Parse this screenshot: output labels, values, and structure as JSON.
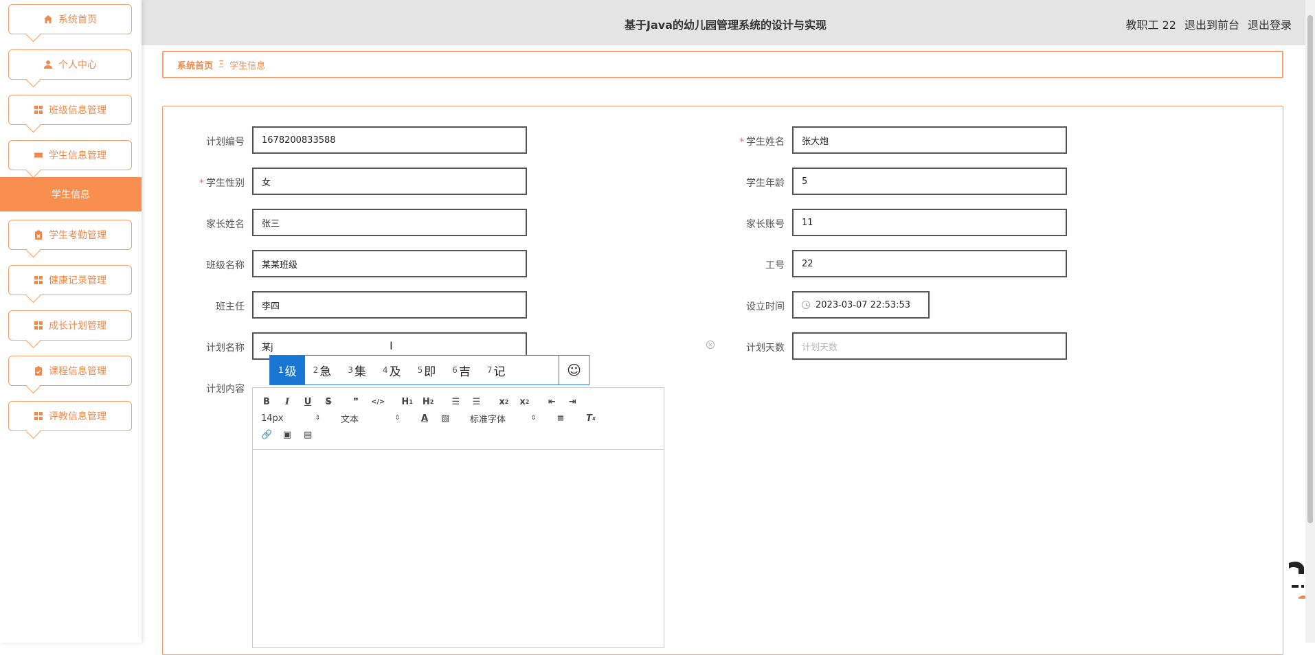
{
  "sidebar": {
    "items": [
      {
        "label": "系统首页",
        "icon": "home-icon"
      },
      {
        "label": "个人中心",
        "icon": "user-icon"
      },
      {
        "label": "班级信息管理",
        "icon": "grid-icon"
      },
      {
        "label": "学生信息管理",
        "icon": "ticket-icon"
      },
      {
        "label": "学生考勤管理",
        "icon": "clipboard-icon"
      },
      {
        "label": "健康记录管理",
        "icon": "grid-icon"
      },
      {
        "label": "成长计划管理",
        "icon": "grid-icon"
      },
      {
        "label": "课程信息管理",
        "icon": "clipboard-icon"
      },
      {
        "label": "评教信息管理",
        "icon": "grid-icon"
      }
    ],
    "active_sub": "学生信息"
  },
  "header": {
    "title": "基于Java的幼儿园管理系统的设计与实现",
    "user": "教职工 22",
    "to_front": "退出到前台",
    "logout": "退出登录"
  },
  "breadcrumb": {
    "home": "系统首页",
    "sep": "Ξ",
    "current": "学生信息"
  },
  "form": {
    "plan_no": {
      "label": "计划编号",
      "value": "1678200833588"
    },
    "student_name": {
      "label": "学生姓名",
      "value": "张大炮",
      "required": "*"
    },
    "gender": {
      "label": "学生性别",
      "value": "女",
      "required": "*"
    },
    "age": {
      "label": "学生年龄",
      "value": "5"
    },
    "parent_name": {
      "label": "家长姓名",
      "value": "张三"
    },
    "parent_account": {
      "label": "家长账号",
      "value": "11"
    },
    "class_name": {
      "label": "班级名称",
      "value": "某某班级"
    },
    "staff_no": {
      "label": "工号",
      "value": "22"
    },
    "head_teacher": {
      "label": "班主任",
      "value": "李四"
    },
    "set_time": {
      "label": "设立时间",
      "value": "2023-03-07 22:53:53"
    },
    "plan_name": {
      "label": "计划名称",
      "value": "某j"
    },
    "plan_days": {
      "label": "计划天数",
      "placeholder": "计划天数"
    },
    "plan_content": {
      "label": "计划内容"
    }
  },
  "ime": {
    "candidates": [
      {
        "n": "1",
        "c": "级"
      },
      {
        "n": "2",
        "c": "急"
      },
      {
        "n": "3",
        "c": "集"
      },
      {
        "n": "4",
        "c": "及"
      },
      {
        "n": "5",
        "c": "即"
      },
      {
        "n": "6",
        "c": "吉"
      },
      {
        "n": "7",
        "c": "记"
      }
    ],
    "emoji": "☺"
  },
  "editor": {
    "font_size": "14px",
    "block": "文本",
    "font": "标准字体"
  },
  "colors": {
    "accent": "#f08a4b",
    "active_bg": "#f88f4e",
    "ime_selected": "#1976d2"
  }
}
